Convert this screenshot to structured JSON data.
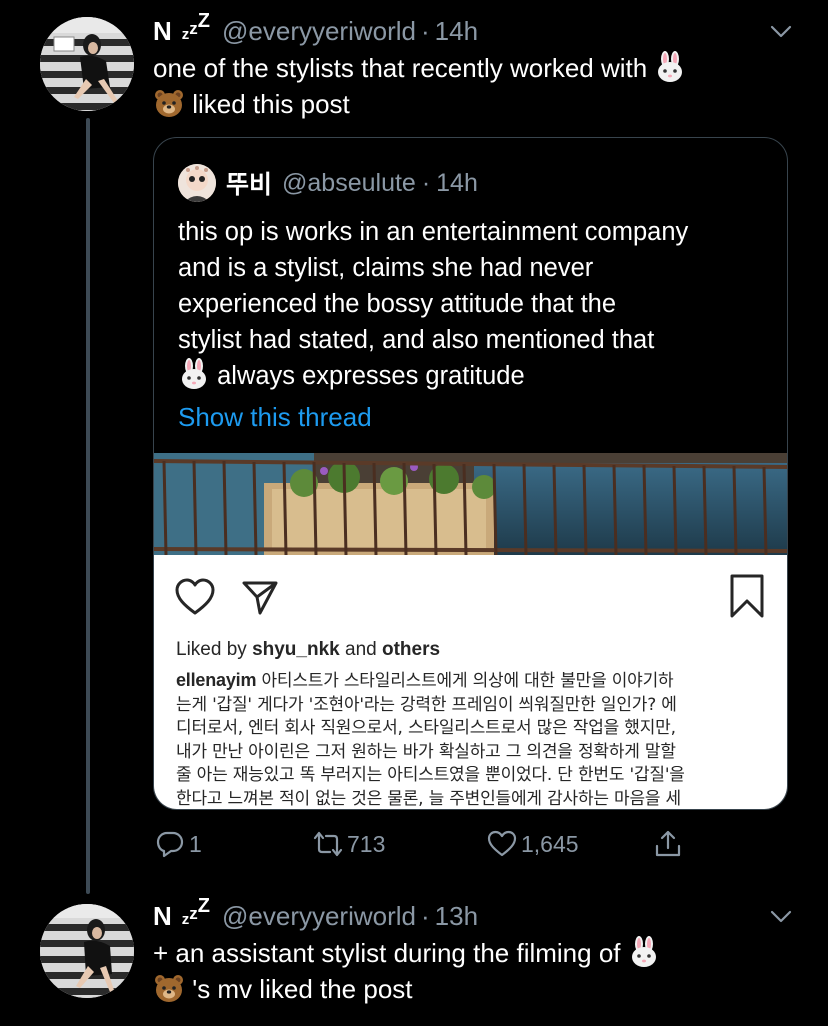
{
  "tweet1": {
    "name": "N",
    "zzz": [
      "z",
      "z",
      "Z"
    ],
    "handle": "@everyyeriworld",
    "dot": "·",
    "time": "14h",
    "text_line1": "one of the stylists that recently worked with",
    "text_line2": "liked this post",
    "emojis": [
      "rabbit-face",
      "bear-face"
    ]
  },
  "quote": {
    "name": "뚜비",
    "handle": "@abseulute",
    "dot": "·",
    "time": "14h",
    "lines": [
      "this op is works in an entertainment company",
      "and is a stylist, claims she had never",
      "experienced the bossy attitude that the",
      "stylist had stated, and also mentioned that",
      "always expresses gratitude"
    ],
    "show_thread": "Show this thread",
    "instagram": {
      "liked_prefix": "Liked by",
      "liked_user": "shyu_nkk",
      "liked_and": "and",
      "liked_others": "others",
      "caption_user": "ellenayim",
      "caption_lines": [
        "아티스트가 스타일리스트에게 의상에 대한 불만을 이야기하",
        "는게 '갑질' 게다가 '조현아'라는 강력한 프레임이 씌워질만한 일인가? 에",
        "디터로서, 엔터 회사 직원으로서, 스타일리스트로서 많은 작업을 했지만,",
        "내가 만난 아이린은 그저 원하는 바가 확실하고 그 의견을 정확하게 말할",
        "줄 아는 재능있고 똑 부러지는 아티스트였을 뿐이었다. 단 한번도 '갑질'을",
        "한다고 느껴본 적이 없는 것은 물론, 늘 주변인들에게 감사하는 마음을 세"
      ]
    }
  },
  "actions": {
    "replies": "1",
    "retweets": "713",
    "likes": "1,645"
  },
  "tweet2": {
    "name": "N",
    "zzz": [
      "z",
      "z",
      "Z"
    ],
    "handle": "@everyyeriworld",
    "dot": "·",
    "time": "13h",
    "text_line1": "+ an assistant stylist during the filming of",
    "text_line2": "'s mv liked the post"
  },
  "colors": {
    "background": "#000000",
    "secondary_text": "#8b98a5",
    "link": "#1d9bf0",
    "border": "#38444d"
  },
  "icons": [
    "chevron-down-icon",
    "reply-icon",
    "retweet-icon",
    "like-icon",
    "share-icon",
    "heart-icon",
    "send-icon",
    "bookmark-icon"
  ]
}
